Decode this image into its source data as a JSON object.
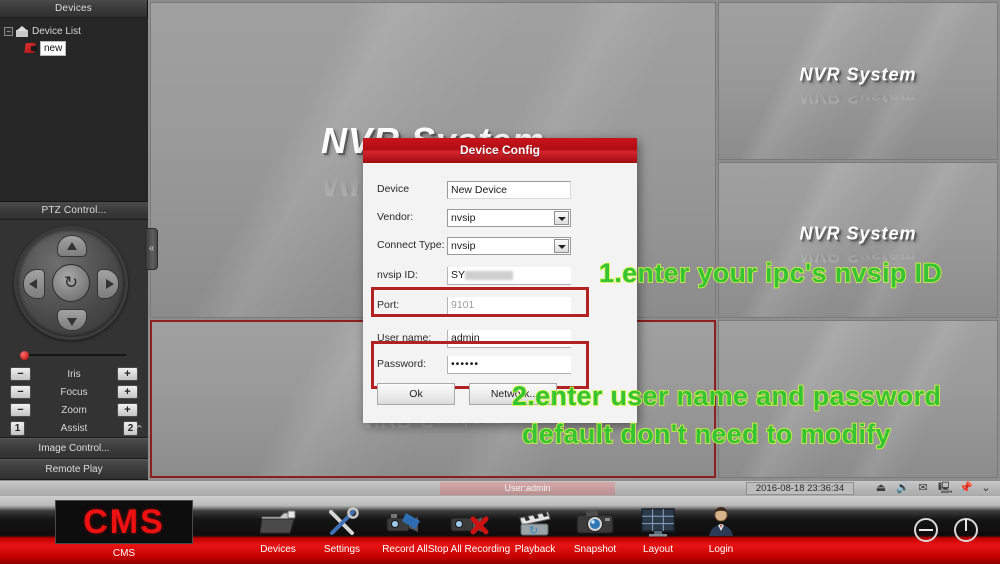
{
  "sidebar": {
    "devices_header": "Devices",
    "tree": {
      "expander": "−",
      "root_label": "Device List",
      "child_label": "new"
    },
    "ptz_header": "PTZ Control...",
    "ptz": {
      "center_icon": "refresh-icon",
      "rows": [
        {
          "label": "Iris",
          "minus": "−",
          "plus": "+"
        },
        {
          "label": "Focus",
          "minus": "−",
          "plus": "+"
        },
        {
          "label": "Zoom",
          "minus": "−",
          "plus": "+"
        },
        {
          "label": "Assist",
          "minus": "1",
          "plus": "2"
        }
      ],
      "collapse": "⌃"
    },
    "image_control": "Image Control...",
    "remote_play": "Remote Play",
    "collapse_arrow": "«"
  },
  "video": {
    "watermark": "NVR System",
    "panes": [
      {
        "id": "pane-1",
        "label": "NVR System"
      },
      {
        "id": "pane-2",
        "label": "NVR System"
      },
      {
        "id": "pane-3",
        "label": "NVR System"
      },
      {
        "id": "pane-4",
        "label": "NVR System"
      }
    ]
  },
  "statusbar": {
    "user": "User:admin",
    "time": "2016-08-18 23:36:34",
    "tray": [
      {
        "name": "eject-icon",
        "glyph": "⏏"
      },
      {
        "name": "volume-icon",
        "glyph": "🔊"
      },
      {
        "name": "mail-icon",
        "glyph": "✉"
      },
      {
        "name": "monitor-icon",
        "glyph": "🖳"
      },
      {
        "name": "pin-icon",
        "glyph": "📌"
      },
      {
        "name": "chevrons-down-icon",
        "glyph": "⌄"
      }
    ]
  },
  "taskbar": {
    "logo": "CMS",
    "logo_label": "CMS",
    "items": [
      {
        "name": "devices",
        "label": "Devices",
        "icon": "camera-folder-icon"
      },
      {
        "name": "settings",
        "label": "Settings",
        "icon": "tools-icon"
      },
      {
        "name": "record-all",
        "label": "Record All",
        "icon": "camcorder-record-icon"
      },
      {
        "name": "stop-all-recording",
        "label": "Stop All Recording",
        "icon": "camcorder-stop-icon"
      },
      {
        "name": "playback",
        "label": "Playback",
        "icon": "clapperboard-icon"
      },
      {
        "name": "snapshot",
        "label": "Snapshot",
        "icon": "photo-camera-icon"
      },
      {
        "name": "layout",
        "label": "Layout",
        "icon": "grid-monitor-icon"
      },
      {
        "name": "login",
        "label": "Login",
        "icon": "user-icon"
      }
    ],
    "minimize_icon": "minimize-icon",
    "power_icon": "power-icon"
  },
  "dialog": {
    "title": "Device Config",
    "fields": {
      "device": {
        "label": "Device",
        "value": "New Device"
      },
      "vendor": {
        "label": "Vendor:",
        "value": "nvsip"
      },
      "connect_type": {
        "label": "Connect Type:",
        "value": "nvsip"
      },
      "nvsip_id": {
        "label": "nvsip ID:",
        "value": "SY"
      },
      "port": {
        "label": "Port:",
        "value": "9101"
      },
      "user_name": {
        "label": "User name:",
        "value": "admin"
      },
      "password": {
        "label": "Password:",
        "value": "••••••"
      }
    },
    "buttons": {
      "ok": "Ok",
      "network": "Network.."
    }
  },
  "annotations": [
    "1.enter your ipc's nvsip ID",
    "2.enter user name and password",
    "default don't need to modify"
  ],
  "colors": {
    "accent_red": "#b32222",
    "title_red": "#c8141c",
    "annotation_green": "#35c435",
    "annotation_stroke": "#d8f542"
  }
}
